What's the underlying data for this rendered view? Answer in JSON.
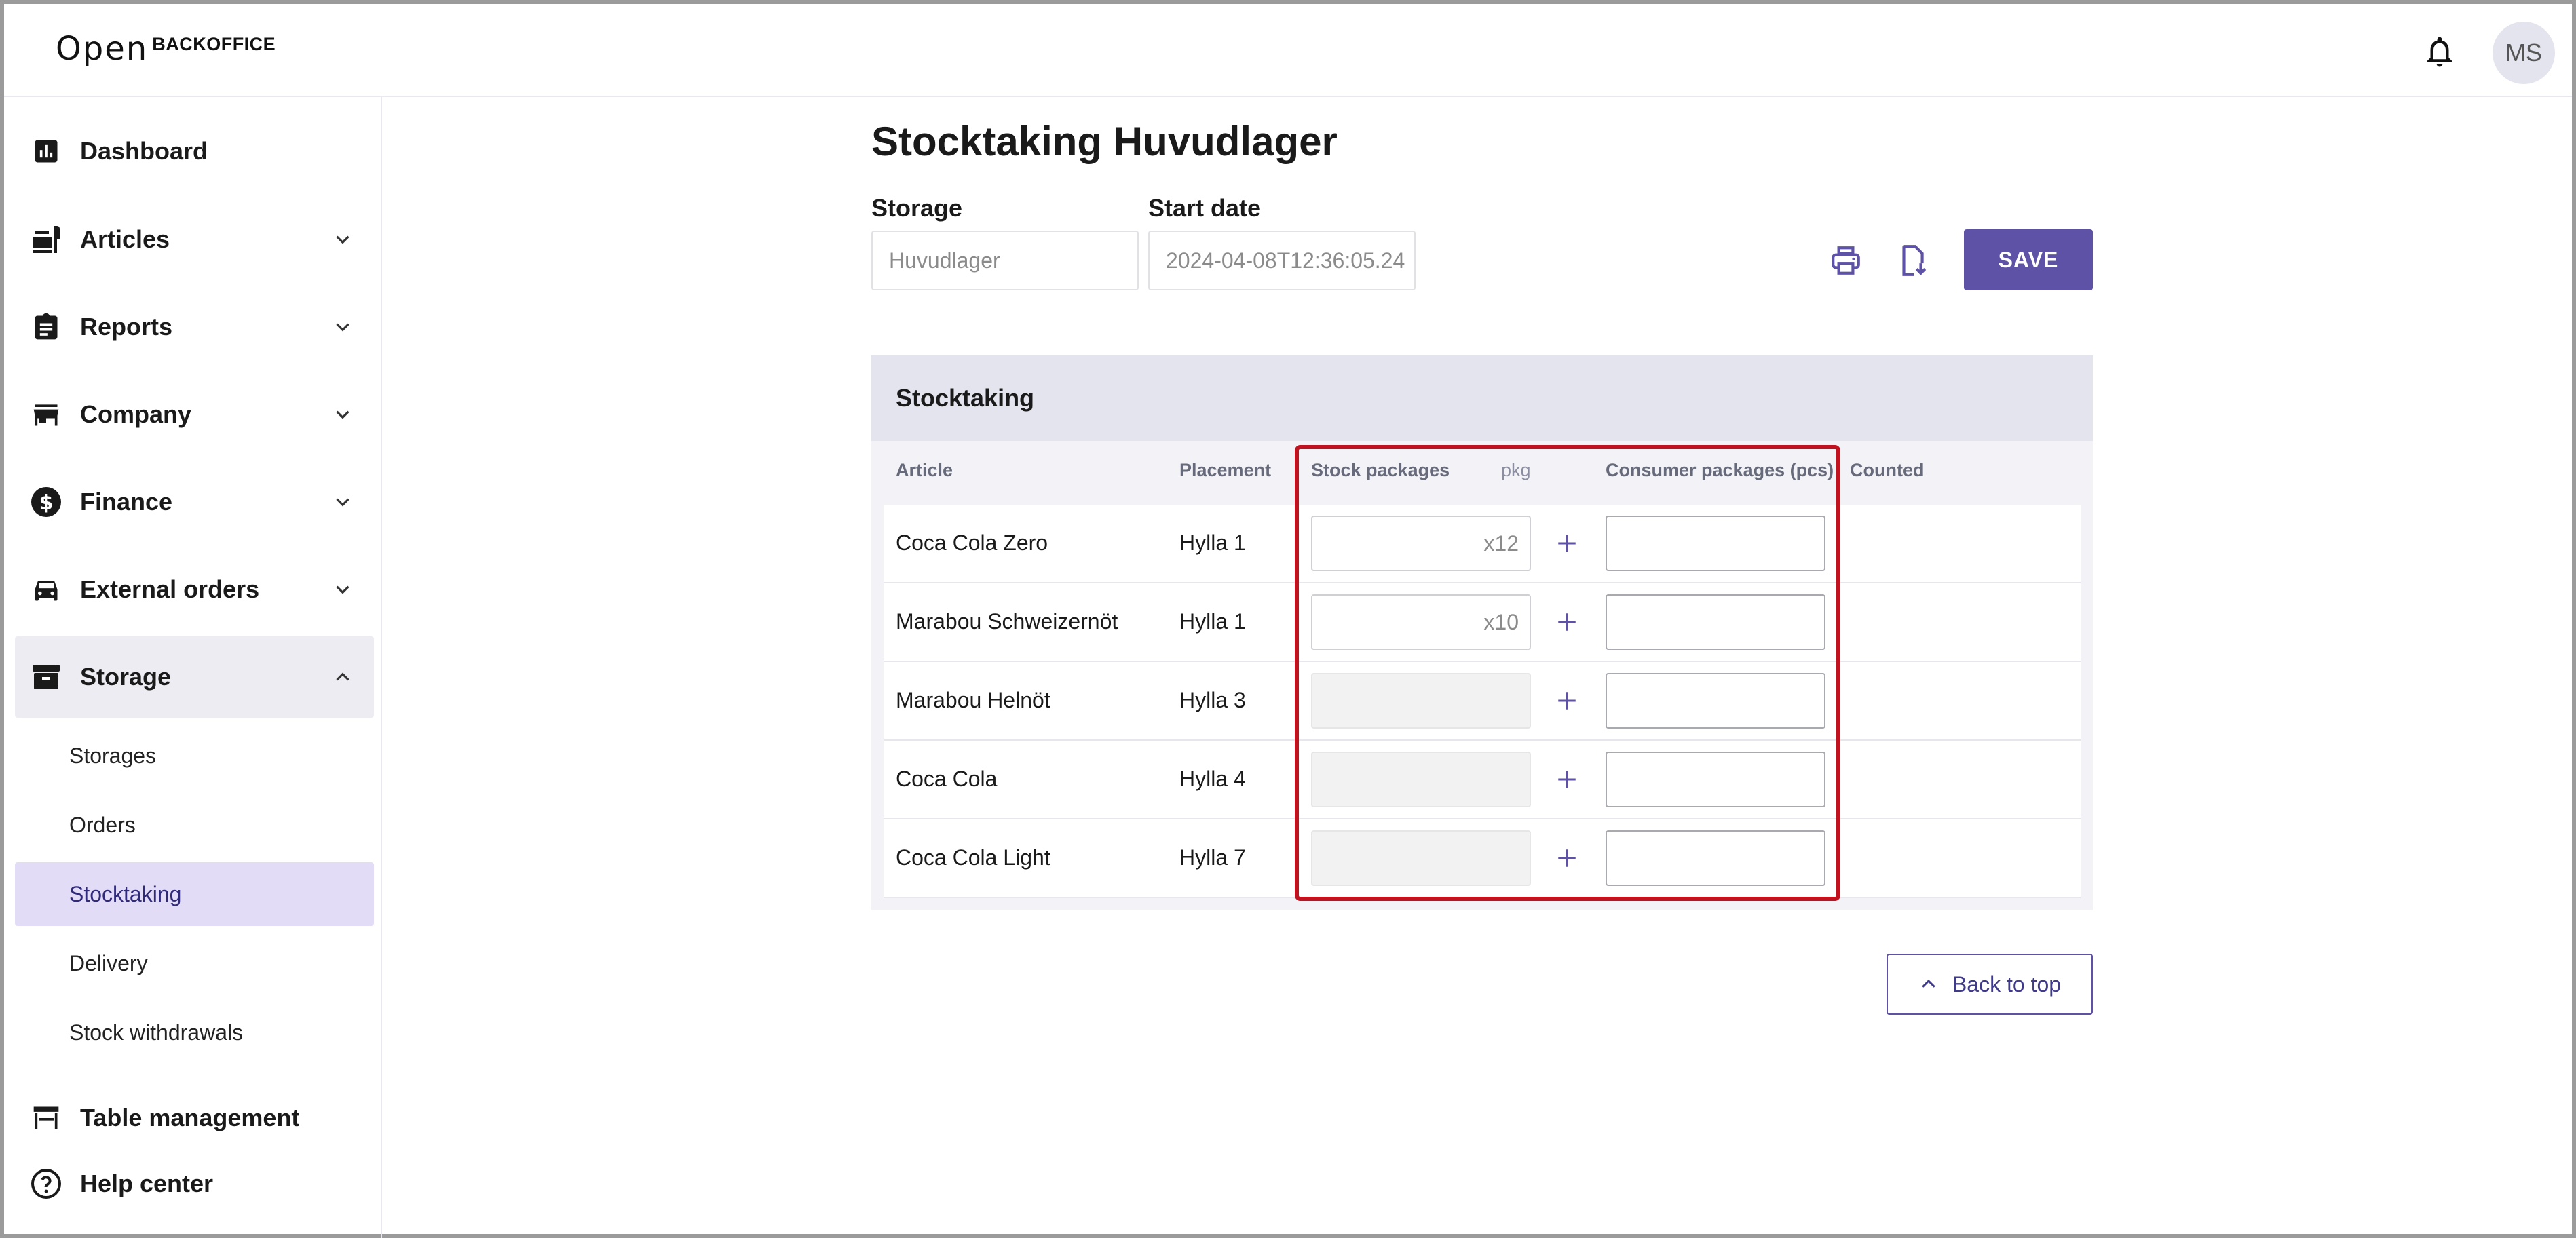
{
  "header": {
    "logo_mark": "Open",
    "logo_text": "BACKOFFICE",
    "avatar_initials": "MS",
    "icons": [
      "bell-icon"
    ]
  },
  "sidebar": {
    "items": [
      {
        "label": "Dashboard",
        "icon": "bar-chart-icon"
      },
      {
        "label": "Articles",
        "icon": "food-icon"
      },
      {
        "label": "Reports",
        "icon": "clipboard-icon"
      },
      {
        "label": "Company",
        "icon": "store-icon"
      },
      {
        "label": "Finance",
        "icon": "dollar-icon"
      },
      {
        "label": "External orders",
        "icon": "car-icon"
      },
      {
        "label": "Storage",
        "icon": "archive-icon"
      }
    ],
    "storage_subitems": [
      "Storages",
      "Orders",
      "Stocktaking",
      "Delivery",
      "Stock withdrawals"
    ],
    "active_subitem": "Stocktaking",
    "bottom_items": [
      {
        "label": "Table management",
        "icon": "table-icon"
      },
      {
        "label": "Help center",
        "icon": "help-icon"
      }
    ]
  },
  "page": {
    "title": "Stocktaking Huvudlager",
    "storage_label": "Storage",
    "storage_value": "Huvudlager",
    "start_date_label": "Start date",
    "start_date_value": "2024-04-08T12:36:05.24",
    "save_label": "SAVE",
    "back_to_top_label": "Back to top"
  },
  "table": {
    "title": "Stocktaking",
    "columns": {
      "article": "Article",
      "placement": "Placement",
      "stock_packages": "Stock packages",
      "pkg": "pkg",
      "consumer_packages": "Consumer packages (pcs)",
      "counted": "Counted"
    },
    "rows": [
      {
        "article": "Coca Cola Zero",
        "placement": "Hylla 1",
        "stock_suffix": "x12",
        "enabled": true
      },
      {
        "article": "Marabou Schweizernöt",
        "placement": "Hylla 1",
        "stock_suffix": "x10",
        "enabled": true
      },
      {
        "article": "Marabou Helnöt",
        "placement": "Hylla 3",
        "stock_suffix": "",
        "enabled": false
      },
      {
        "article": "Coca Cola",
        "placement": "Hylla 4",
        "stock_suffix": "",
        "enabled": false
      },
      {
        "article": "Coca Cola Light",
        "placement": "Hylla 7",
        "stock_suffix": "",
        "enabled": false
      }
    ]
  },
  "colors": {
    "accent": "#5e52a6",
    "highlight": "#c1121f",
    "active_bg": "#e2dcf6"
  }
}
